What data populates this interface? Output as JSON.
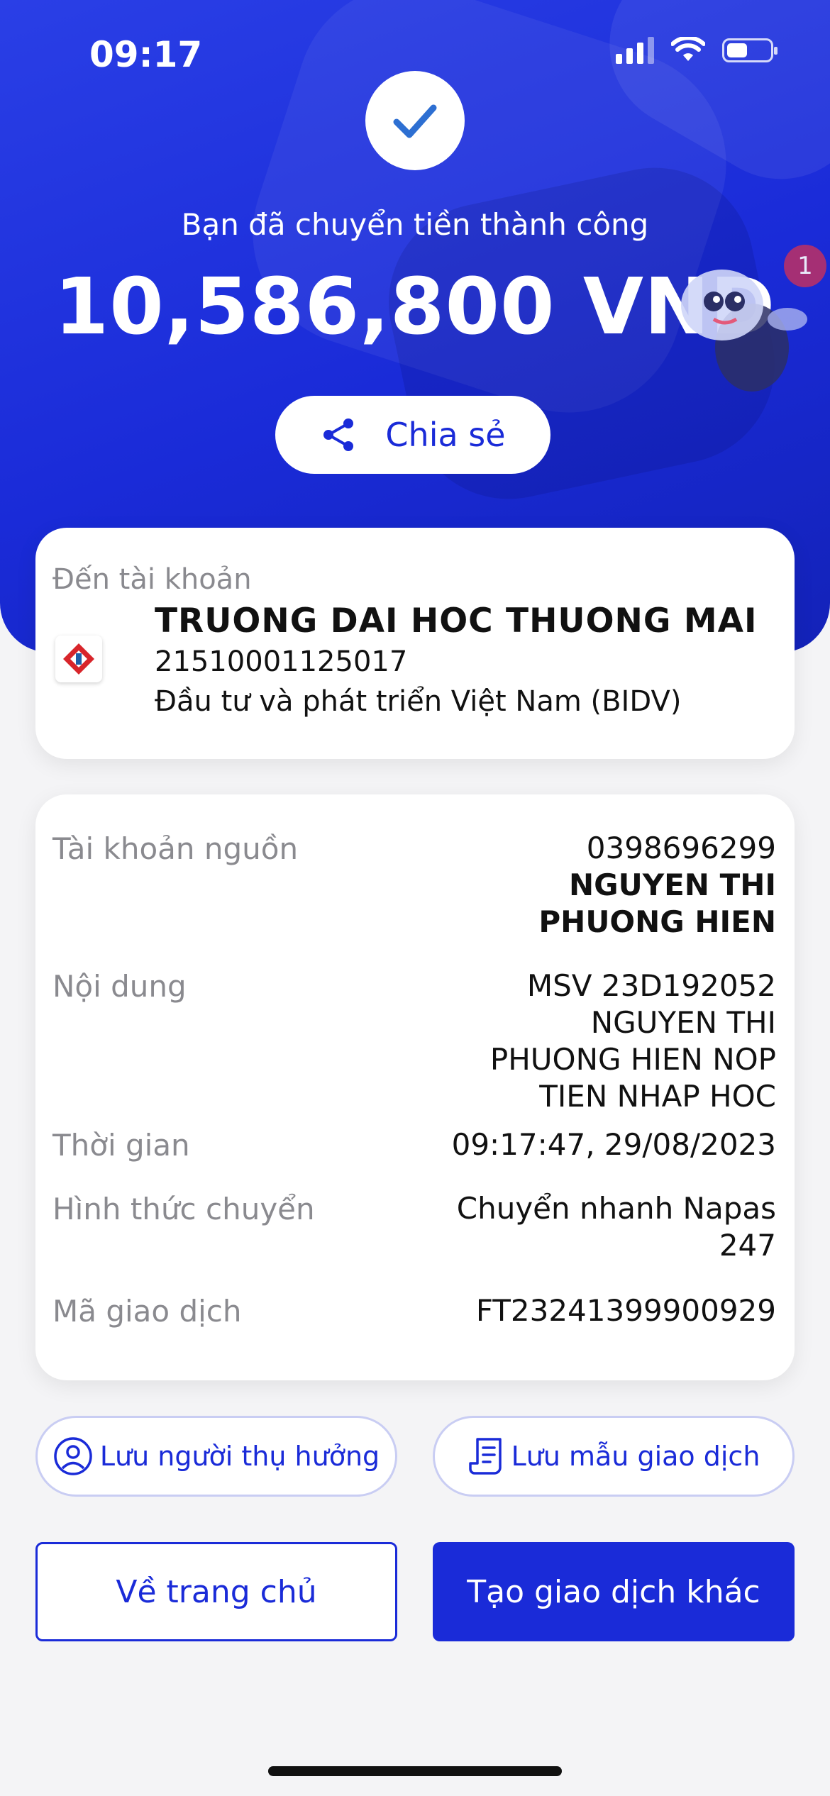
{
  "status_bar": {
    "time": "09:17",
    "icons": [
      "signal-icon",
      "wifi-icon",
      "battery-icon"
    ]
  },
  "result": {
    "message": "Bạn đã chuyển tiền thành công",
    "amount": "10,586,800 VND",
    "share_label": "Chia sẻ",
    "notification_count": "1"
  },
  "destination": {
    "label": "Đến tài khoản",
    "name": "TRUONG DAI HOC THUONG MAI",
    "account": "21510001125017",
    "bank": "Đầu tư và phát triển Việt Nam (BIDV)"
  },
  "details": {
    "source_label": "Tài khoản nguồn",
    "source_account": "0398696299",
    "source_name_1": "NGUYEN THI",
    "source_name_2": "PHUONG HIEN",
    "content_label": "Nội dung",
    "content_1": "MSV 23D192052",
    "content_2": "NGUYEN THI",
    "content_3": "PHUONG HIEN NOP",
    "content_4": "TIEN NHAP HOC",
    "time_label": "Thời gian",
    "time_value": "09:17:47, 29/08/2023",
    "method_label": "Hình thức chuyển",
    "method_1": "Chuyển nhanh Napas",
    "method_2": "247",
    "txn_label": "Mã giao dịch",
    "txn_value": "FT23241399900929"
  },
  "actions": {
    "save_beneficiary": "Lưu người thụ hưởng",
    "save_template": "Lưu mẫu giao dịch",
    "home": "Về trang chủ",
    "new_transaction": "Tạo giao dịch khác"
  },
  "colors": {
    "primary": "#1a2bd8",
    "background": "#f4f4f6"
  }
}
